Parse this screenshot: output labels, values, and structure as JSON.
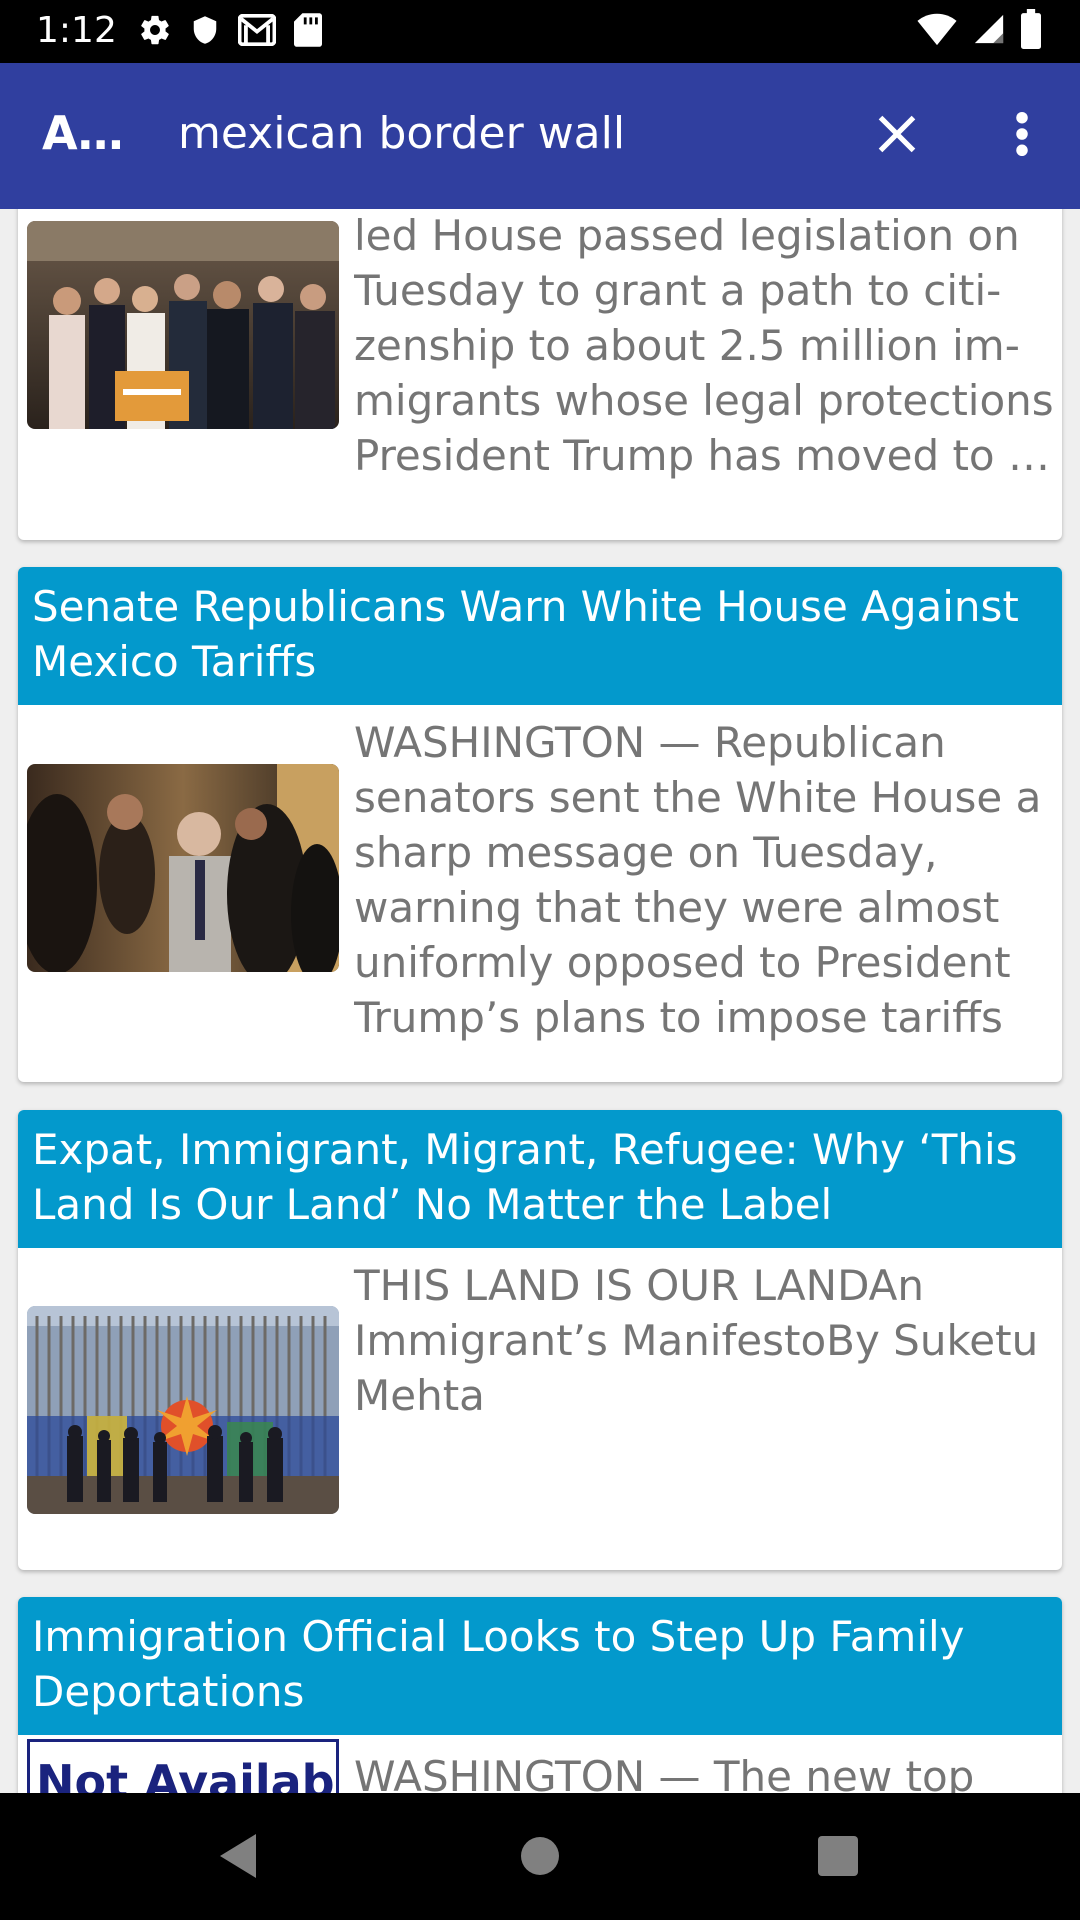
{
  "status_bar": {
    "time": "1:12",
    "icons": [
      "gear-icon",
      "shield-icon",
      "gmail-icon",
      "sd-card-icon",
      "wifi-icon",
      "signal-icon",
      "battery-icon"
    ]
  },
  "app_bar": {
    "title": "A…",
    "search_query": "mexican border wall",
    "icons": [
      "close-icon",
      "more-vert-icon"
    ]
  },
  "articles": [
    {
      "title": "",
      "snippet": "WASHINGTON — The Democrat-led House passed legislation on Tuesday to grant a path to citi-zenship to about 2.5 million im-migrants whose legal protections President Trump has moved to …",
      "image": "house-democrats-press-conference"
    },
    {
      "title": "Senate Republicans Warn White House Against Mexico Tariffs",
      "snippet": "WASHINGTON — Republican senators sent the White House a sharp message on Tuesday, warning that they were almost uniformly opposed to President Trump’s plans to impose tariffs …",
      "image": "senator-in-crowd"
    },
    {
      "title": "Expat, Immigrant, Migrant, Refugee: Why ‘This Land Is Our Land’ No Matter the Label",
      "snippet": "THIS LAND IS OUR LANDAn Immigrant’s ManifestoBy Suketu Mehta",
      "image": "border-wall-mural"
    },
    {
      "title": "Immigration Official Looks to Step Up Family Deportations",
      "snippet": "WASHINGTON — The new top",
      "image_text": "Not Available"
    }
  ],
  "nav_bar": {
    "icons": [
      "back-icon",
      "home-icon",
      "recents-icon"
    ]
  },
  "colors": {
    "status_bar": "#000000",
    "app_bar": "#303f9f",
    "card_header": "#0399cc",
    "snippet_text": "#757575",
    "background": "#efefef"
  }
}
